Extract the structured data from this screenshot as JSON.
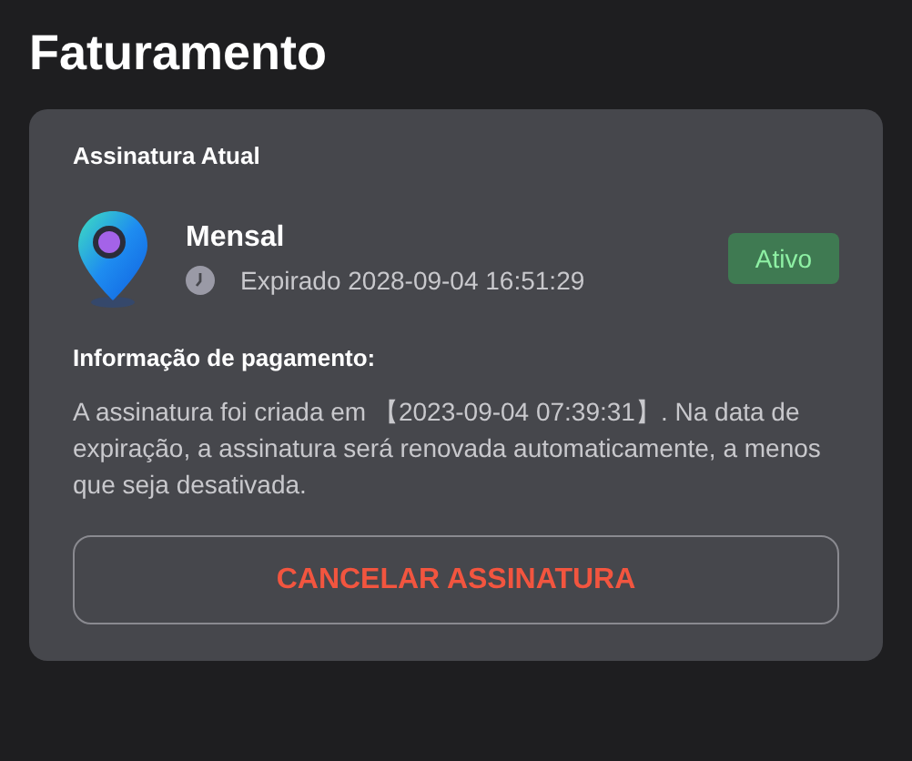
{
  "page": {
    "title": "Faturamento"
  },
  "subscription": {
    "heading": "Assinatura Atual",
    "plan": "Mensal",
    "expiry": "Expirado 2028-09-04 16:51:29",
    "status": {
      "label": "Ativo",
      "kind": "active"
    }
  },
  "payment": {
    "heading": "Informação de pagamento:",
    "text": "A assinatura foi criada em 【2023-09-04 07:39:31】. Na data de expiração, a assinatura será renovada automaticamente, a menos que seja desativada."
  },
  "buttons": [
    {
      "label": "CANCELAR ASSINATURA",
      "kind": "danger"
    }
  ]
}
